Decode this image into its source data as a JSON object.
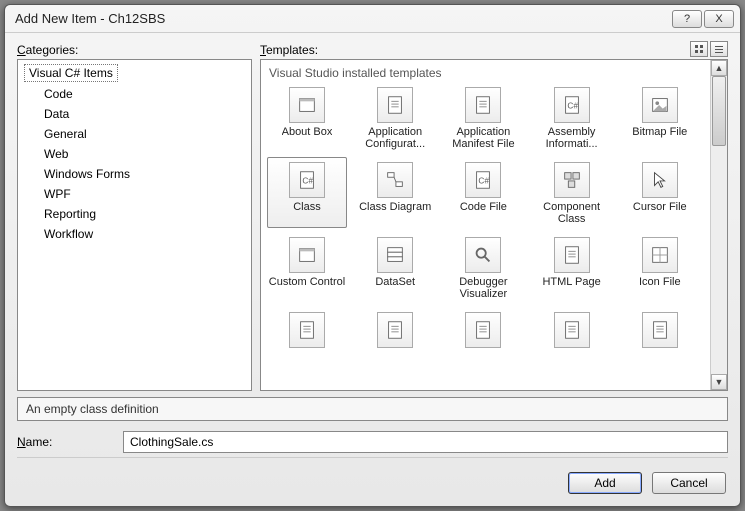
{
  "window": {
    "title": "Add New Item - Ch12SBS",
    "help_label": "?",
    "close_label": "X"
  },
  "categories": {
    "label_prefix": "C",
    "label_rest": "ategories:",
    "root": "Visual C# Items",
    "items": [
      "Code",
      "Data",
      "General",
      "Web",
      "Windows Forms",
      "WPF",
      "Reporting",
      "Workflow"
    ]
  },
  "templates": {
    "label_prefix": "T",
    "label_rest": "emplates:",
    "group_label": "Visual Studio installed templates",
    "items": [
      {
        "label": "About Box",
        "icon": "form",
        "selected": false
      },
      {
        "label": "Application Configurat...",
        "icon": "doc",
        "selected": false
      },
      {
        "label": "Application Manifest File",
        "icon": "doc",
        "selected": false
      },
      {
        "label": "Assembly Informati...",
        "icon": "cs",
        "selected": false
      },
      {
        "label": "Bitmap File",
        "icon": "img",
        "selected": false
      },
      {
        "label": "Class",
        "icon": "cs",
        "selected": true
      },
      {
        "label": "Class Diagram",
        "icon": "diagram",
        "selected": false
      },
      {
        "label": "Code File",
        "icon": "cs",
        "selected": false
      },
      {
        "label": "Component Class",
        "icon": "component",
        "selected": false
      },
      {
        "label": "Cursor File",
        "icon": "cursor",
        "selected": false
      },
      {
        "label": "Custom Control",
        "icon": "form",
        "selected": false
      },
      {
        "label": "DataSet",
        "icon": "dataset",
        "selected": false
      },
      {
        "label": "Debugger Visualizer",
        "icon": "search",
        "selected": false
      },
      {
        "label": "HTML Page",
        "icon": "doc",
        "selected": false
      },
      {
        "label": "Icon File",
        "icon": "grid",
        "selected": false
      }
    ],
    "partial_row_labels": [
      "",
      "",
      "",
      "",
      ""
    ]
  },
  "description": "An empty class definition",
  "name": {
    "label_prefix": "N",
    "label_rest": "ame:",
    "value": "ClothingSale.cs"
  },
  "buttons": {
    "add": "Add",
    "cancel": "Cancel"
  }
}
